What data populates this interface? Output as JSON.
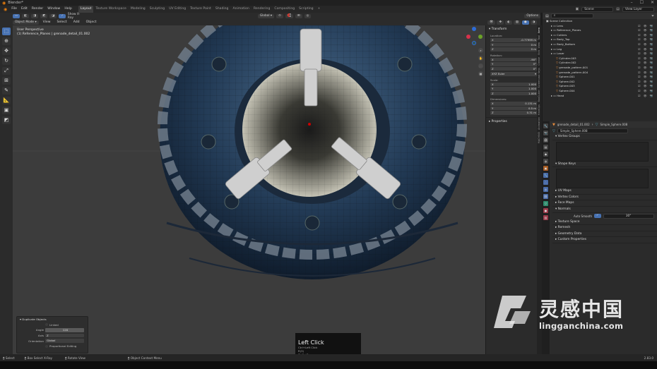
{
  "window": {
    "title": "Blender*",
    "controls": [
      "–",
      "☐",
      "✕"
    ]
  },
  "menubar": {
    "menus": [
      "File",
      "Edit",
      "Render",
      "Window",
      "Help"
    ],
    "workspaces": [
      "Layout",
      "Texture Workspace",
      "Modeling",
      "Sculpting",
      "UV Editing",
      "Texture Paint",
      "Shading",
      "Animation",
      "Rendering",
      "Compositing",
      "Scripting"
    ],
    "active_workspace": "Layout",
    "add_tab": "+",
    "scene_label": "Scene",
    "view_layer_label": "View Layer"
  },
  "tool_header": {
    "show_xray": "Show X-Ray",
    "transform_orientation": "Global",
    "options": "Options"
  },
  "view_header": {
    "mode": "Object Mode",
    "menus": [
      "View",
      "Select",
      "Add",
      "Object"
    ]
  },
  "viewport": {
    "info_line1": "User Perspective",
    "info_line2": "(1) Reference_Planes | grenade_detail_01.002"
  },
  "gizmo": {
    "axes": [
      "X",
      "Y",
      "Z"
    ]
  },
  "npanel": {
    "transform_title": "Transform",
    "location_label": "Location:",
    "location": [
      [
        "X",
        "-0.77999 m"
      ],
      [
        "Y",
        "0 m"
      ],
      [
        "Z",
        "0 m"
      ]
    ],
    "rotation_label": "Rotation:",
    "rotation": [
      [
        "X",
        "-90°"
      ],
      [
        "Y",
        "0°"
      ],
      [
        "Z",
        "0°"
      ]
    ],
    "rotation_mode": "XYZ Euler",
    "scale_label": "Scale:",
    "scale": [
      [
        "X",
        "1.000"
      ],
      [
        "Y",
        "1.000"
      ],
      [
        "Z",
        "1.000"
      ]
    ],
    "dimensions_label": "Dimensions:",
    "dimensions": [
      [
        "X",
        "0.131 m"
      ],
      [
        "Y",
        "0.5 m"
      ],
      [
        "Z",
        "0.31 m"
      ]
    ],
    "properties_title": "Properties",
    "tabs": [
      "Item",
      "Tool",
      "View",
      "Edit",
      "Create",
      "Screencast Keys",
      "BoxCutter",
      "HardOps",
      "Animation",
      "MACHIN3"
    ]
  },
  "outliner": {
    "root": "Scene Collection",
    "items": [
      {
        "name": "Lens",
        "indent": 1,
        "type": "coll"
      },
      {
        "name": "Reference_Planes",
        "indent": 1,
        "type": "coll"
      },
      {
        "name": "Cutters",
        "indent": 1,
        "type": "coll"
      },
      {
        "name": "Body_Top",
        "indent": 1,
        "type": "coll"
      },
      {
        "name": "Body_Bottom",
        "indent": 1,
        "type": "coll"
      },
      {
        "name": "Leg",
        "indent": 1,
        "type": "coll"
      },
      {
        "name": "Laser",
        "indent": 1,
        "type": "coll"
      },
      {
        "name": "Cylinder.003",
        "indent": 2,
        "type": "mesh"
      },
      {
        "name": "Cylinder.002",
        "indent": 2,
        "type": "mesh"
      },
      {
        "name": "grenade_pattern.001",
        "indent": 2,
        "type": "mesh"
      },
      {
        "name": "grenade_pattern.004",
        "indent": 2,
        "type": "mesh"
      },
      {
        "name": "Sphere.001",
        "indent": 2,
        "type": "mesh"
      },
      {
        "name": "Sphere.002",
        "indent": 2,
        "type": "mesh"
      },
      {
        "name": "Sphere.003",
        "indent": 2,
        "type": "mesh"
      },
      {
        "name": "Sphere.004",
        "indent": 2,
        "type": "mesh"
      },
      {
        "name": "Head",
        "indent": 1,
        "type": "coll"
      }
    ]
  },
  "properties": {
    "object_name": "grenade_detail_01.002",
    "mesh_name": "Simple_Sphere.008",
    "data_field": "Simple_Sphere.008",
    "sections": [
      "Vertex Groups",
      "Shape Keys",
      "UV Maps",
      "Vertex Colors",
      "Face Maps",
      "Normals"
    ],
    "auto_smooth_label": "Auto Smooth",
    "auto_smooth_angle": "30°",
    "sections2": [
      "Texture Space",
      "Remesh",
      "Geometry Data",
      "Custom Properties"
    ]
  },
  "duplicate_panel": {
    "title": "Duplicate Objects",
    "linked_label": "Linked",
    "angle_label": "Angle",
    "angle_value": "120",
    "axis_label": "Axis",
    "axis_value": "Z",
    "orientation_label": "Orientation",
    "orientation_value": "Global",
    "proportional_label": "Proportional Editing"
  },
  "keypress": {
    "title": "Left Click",
    "lines": [
      "Ctrl+Left Click",
      "R(3)",
      "Shift+D"
    ]
  },
  "statusbar": {
    "items": [
      "Select",
      "Box Select X-Ray",
      "Rotate View",
      "Object Context Menu"
    ],
    "version": "2.83.0"
  },
  "watermark": {
    "cn": "灵感中国",
    "en": "lingganchina.com"
  }
}
